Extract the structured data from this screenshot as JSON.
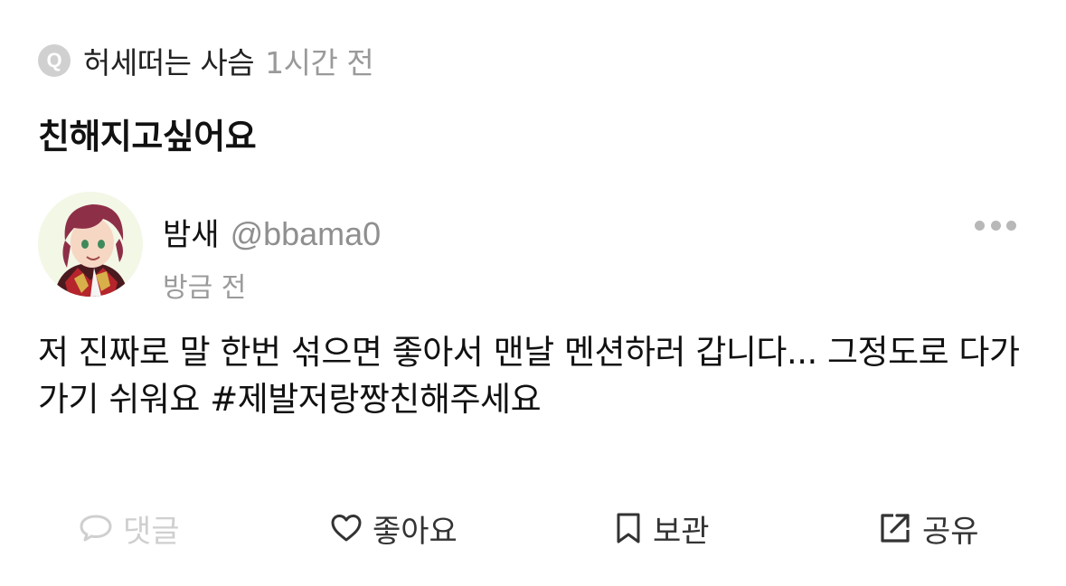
{
  "question": {
    "badge": "Q",
    "asker": "허세떠는 사슴",
    "time": "1시간 전",
    "text": "친해지고싶어요"
  },
  "answer": {
    "author_name": "밤새",
    "author_handle": "@bbama0",
    "time": "방금 전",
    "text": "저 진짜로 말 한번 섞으면 좋아서 맨날 멘션하러 갑니다... 그정도로 다가가기 쉬워요 #제발저랑짱친해주세요"
  },
  "actions": {
    "comment": "댓글",
    "like": "좋아요",
    "save": "보관",
    "share": "공유"
  },
  "colors": {
    "muted": "#9a9a9a",
    "disabled": "#cfcfcf",
    "badge": "#d0d0d0"
  },
  "icons": [
    "comment-icon",
    "heart-icon",
    "bookmark-icon",
    "share-icon",
    "more-icon"
  ]
}
